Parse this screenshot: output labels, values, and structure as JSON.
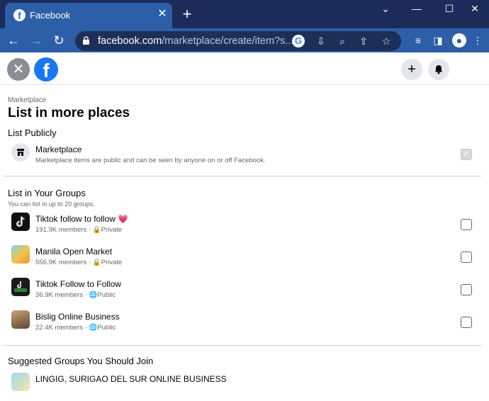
{
  "browser": {
    "tab_title": "Facebook",
    "tab_close": "✕",
    "new_tab": "+",
    "url_host": "facebook.com",
    "url_path": "/marketplace/create/item?s...",
    "window_controls": {
      "minimize": "—",
      "maximize": "☐",
      "close": "✕",
      "dropdown": "⌄"
    }
  },
  "header": {
    "close_glyph": "✕",
    "logo_glyph": "f",
    "add_glyph": "+",
    "bell_glyph": "🔔"
  },
  "page": {
    "breadcrumb": "Marketplace",
    "title": "List in more places",
    "public_section": {
      "title": "List Publicly",
      "item": {
        "name": "Marketplace",
        "description": "Marketplace items are public and can be seen by anyone on or off Facebook.",
        "checked": true
      }
    },
    "groups_section": {
      "title": "List in Your Groups",
      "subtitle": "You can list in up to 20 groups.",
      "groups": [
        {
          "name": "Tiktok follow to follow",
          "members": "191.9K members",
          "privacy": "Private",
          "heart": "💗"
        },
        {
          "name": "Manila Open Market",
          "members": "556.9K members",
          "privacy": "Private"
        },
        {
          "name": "Tiktok Follow to Follow",
          "members": "36.9K members",
          "privacy": "Public"
        },
        {
          "name": "Bislig Online Business",
          "members": "22.4K members",
          "privacy": "Public"
        }
      ]
    },
    "suggested_section": {
      "title": "Suggested Groups You Should Join",
      "first_group": "LINGIG, SURIGAO DEL SUR ONLINE BUSINESS"
    }
  }
}
